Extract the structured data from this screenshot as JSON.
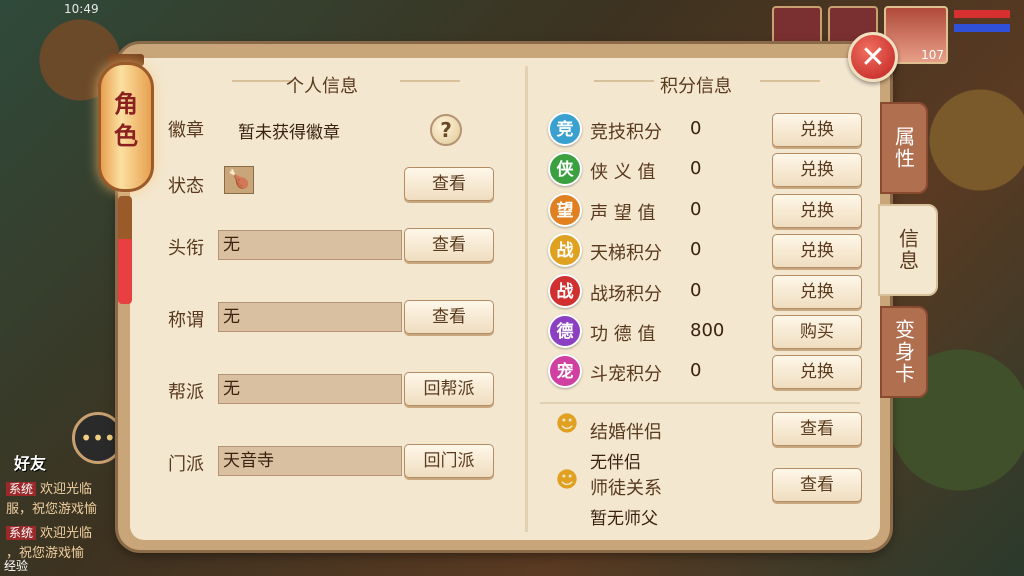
{
  "status": {
    "time": "10:49"
  },
  "avatar": {
    "level": "107"
  },
  "lantern_tab": {
    "label_1": "角",
    "label_2": "色"
  },
  "close": {
    "symbol": "✕"
  },
  "side_tabs": [
    {
      "label": "属性",
      "active": false
    },
    {
      "label": "信息",
      "active": true
    },
    {
      "label": "变身卡",
      "active": false
    }
  ],
  "left": {
    "title": "个人信息",
    "badge": {
      "label": "徽章",
      "value": "暂未获得徽章",
      "help": "?"
    },
    "state": {
      "label": "状态",
      "icon": "food-icon",
      "button": "查看"
    },
    "title_row": {
      "label": "头衔",
      "value": "无",
      "button": "查看"
    },
    "nickname": {
      "label": "称谓",
      "value": "无",
      "button": "查看"
    },
    "guild": {
      "label": "帮派",
      "value": "无",
      "button": "回帮派"
    },
    "school": {
      "label": "门派",
      "value": "天音寺",
      "button": "回门派"
    }
  },
  "right": {
    "title": "积分信息",
    "scores": [
      {
        "icon": "竞",
        "color": "#3aa0d0",
        "label": "竞技积分",
        "value": "0",
        "button": "兑换"
      },
      {
        "icon": "侠",
        "color": "#3aa040",
        "label": "侠 义 值",
        "value": "0",
        "button": "兑换"
      },
      {
        "icon": "望",
        "color": "#e08020",
        "label": "声 望 值",
        "value": "0",
        "button": "兑换"
      },
      {
        "icon": "战",
        "color": "#e0a020",
        "label": "天梯积分",
        "value": "0",
        "button": "兑换"
      },
      {
        "icon": "战",
        "color": "#d03030",
        "label": "战场积分",
        "value": "0",
        "button": "兑换"
      },
      {
        "icon": "德",
        "color": "#8a40c0",
        "label": "功 德 值",
        "value": "800",
        "button": "购买"
      },
      {
        "icon": "宠",
        "color": "#d040a0",
        "label": "斗宠积分",
        "value": "0",
        "button": "兑换"
      }
    ],
    "marriage": {
      "label": "结婚伴侣",
      "value": "无伴侣",
      "button": "查看"
    },
    "mentor": {
      "label": "师徒关系",
      "value": "暂无师父",
      "button": "查看"
    }
  },
  "chat": {
    "friend_label": "好友",
    "lines": [
      {
        "tag": "系统",
        "text": "欢迎光临"
      },
      {
        "tag": "",
        "text": "服，祝您游戏愉"
      },
      {
        "tag": "系统",
        "text": "欢迎光临"
      },
      {
        "tag": "",
        "text": "，祝您游戏愉"
      }
    ],
    "exp_label": "经验"
  }
}
